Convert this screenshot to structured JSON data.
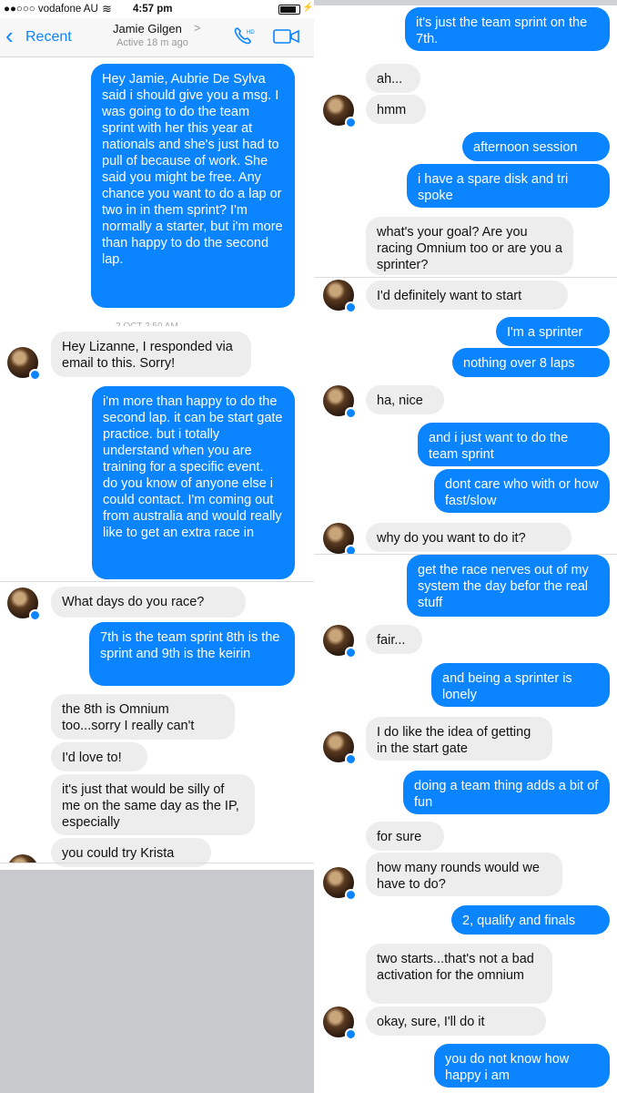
{
  "status": {
    "carrier": "●●○○○ vodafone AU",
    "time": "4:57 pm"
  },
  "header": {
    "back_label": "Recent",
    "contact_name": "Jamie Gilgen",
    "contact_chevron": ">",
    "active_status": "Active 18 m ago",
    "call_icon": "phone-hd-icon",
    "video_icon": "video-camera-icon"
  },
  "timestamp_partial": "2 OCT 2:50 AM",
  "left_messages": [
    {
      "dir": "out",
      "text": "Hey Jamie, Aubrie De Sylva said i should give you a msg.  I was going to do the team sprint with her this year at nationals and she's just had to pull of because of work.  She said you might be free.  Any chance you want to do a lap or two in in them sprint? I'm normally a starter, but i'm more than happy to do the second lap."
    },
    {
      "dir": "in",
      "text": "Hey Lizanne, I responded via email to this. Sorry!"
    },
    {
      "dir": "out",
      "text": "i'm more than happy to do the second lap.  it can be start gate practice.  but i totally understand when you are training for a specific event.\ndo you know of anyone else i could contact.  I'm coming out from australia and would really like to get an extra race in"
    },
    {
      "dir": "in",
      "text": "What days do you race?"
    },
    {
      "dir": "out",
      "text": "7th is the team sprint 8th is the sprint and 9th is the keirin"
    },
    {
      "dir": "in",
      "text": "the 8th is Omnium too...sorry I really can't"
    },
    {
      "dir": "in",
      "text": "I'd love to!"
    },
    {
      "dir": "in",
      "text": "it's just that would be silly of me on the same day as the IP, especially"
    },
    {
      "dir": "in",
      "text": "you could try Krista"
    }
  ],
  "right_messages": [
    {
      "dir": "out",
      "text": "it's just the team sprint on the 7th."
    },
    {
      "dir": "in",
      "text": "ah..."
    },
    {
      "dir": "in",
      "text": "hmm"
    },
    {
      "dir": "out",
      "text": "afternoon session"
    },
    {
      "dir": "out",
      "text": "i have a spare disk and tri spoke"
    },
    {
      "dir": "in",
      "text": "what's your goal? Are you racing Omnium too or are you a sprinter?"
    },
    {
      "dir": "in",
      "text": "I'd definitely want to start"
    },
    {
      "dir": "out",
      "text": "I'm a sprinter"
    },
    {
      "dir": "out",
      "text": "nothing over 8 laps"
    },
    {
      "dir": "in",
      "text": "ha, nice"
    },
    {
      "dir": "out",
      "text": "and i just want to do the team sprint"
    },
    {
      "dir": "out",
      "text": "dont care who with or how fast/slow"
    },
    {
      "dir": "in",
      "text": "why do you want to do it?"
    },
    {
      "dir": "out",
      "text": "get the race nerves out of my system the day befor the real stuff"
    },
    {
      "dir": "in",
      "text": "fair..."
    },
    {
      "dir": "out",
      "text": "and being a sprinter is lonely"
    },
    {
      "dir": "in",
      "text": "I do like the idea of getting in the start gate"
    },
    {
      "dir": "out",
      "text": "doing a team thing adds a bit of fun"
    },
    {
      "dir": "in",
      "text": "for sure"
    },
    {
      "dir": "in",
      "text": "how many rounds would we have to do?"
    },
    {
      "dir": "out",
      "text": "2, qualify and finals"
    },
    {
      "dir": "in",
      "text": "two starts...that's not a bad activation for the omnium"
    },
    {
      "dir": "in",
      "text": "okay, sure, I'll do it"
    },
    {
      "dir": "out",
      "text": "you do not know how happy i am"
    }
  ]
}
